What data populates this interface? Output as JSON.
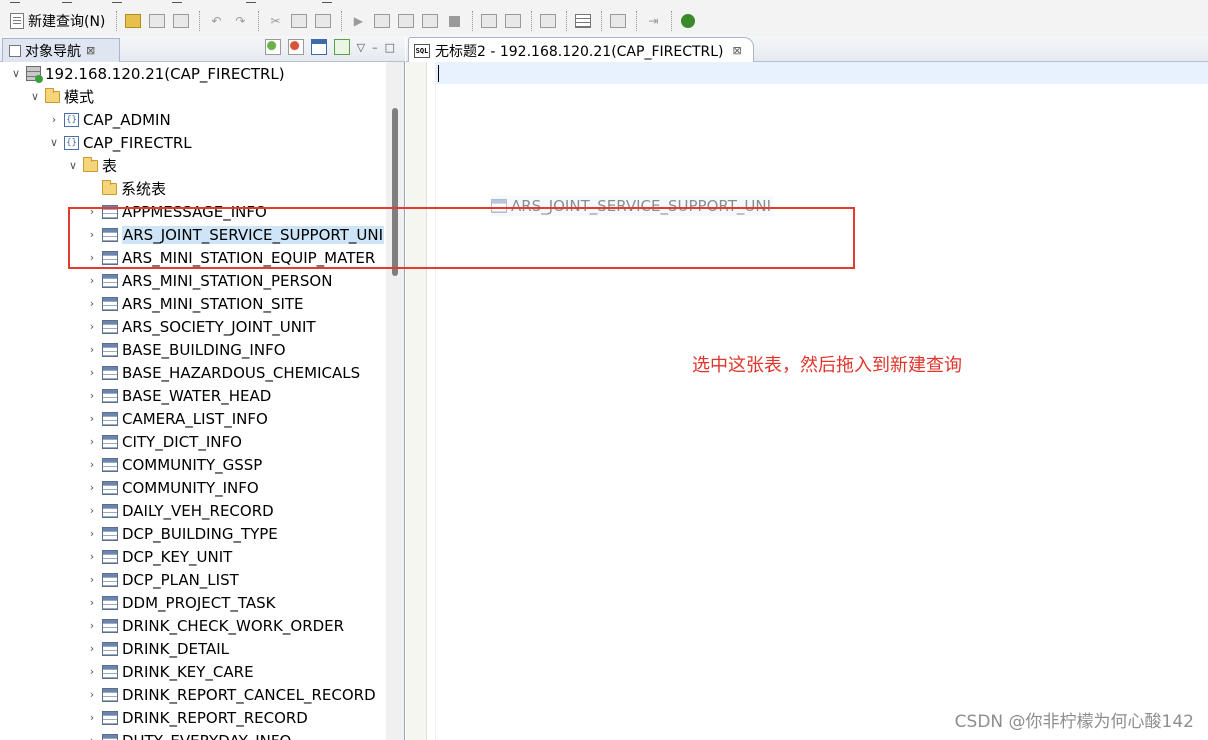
{
  "toolbar": {
    "new_query_label": "新建查询(N)"
  },
  "navigator": {
    "tab_label": "对象导航",
    "tab_close": "⊠",
    "menu_glyph": "▽",
    "minimize_glyph": "–",
    "maximize_glyph": "□"
  },
  "tree": {
    "connection": "192.168.120.21(CAP_FIRECTRL)",
    "schemas_folder": "模式",
    "schema_admin": "CAP_ADMIN",
    "schema_firectrl": "CAP_FIRECTRL",
    "tables_folder": "表",
    "system_tables": "系统表",
    "tables": [
      "APPMESSAGE_INFO",
      "ARS_JOINT_SERVICE_SUPPORT_UNI",
      "ARS_MINI_STATION_EQUIP_MATER",
      "ARS_MINI_STATION_PERSON",
      "ARS_MINI_STATION_SITE",
      "ARS_SOCIETY_JOINT_UNIT",
      "BASE_BUILDING_INFO",
      "BASE_HAZARDOUS_CHEMICALS",
      "BASE_WATER_HEAD",
      "CAMERA_LIST_INFO",
      "CITY_DICT_INFO",
      "COMMUNITY_GSSP",
      "COMMUNITY_INFO",
      "DAILY_VEH_RECORD",
      "DCP_BUILDING_TYPE",
      "DCP_KEY_UNIT",
      "DCP_PLAN_LIST",
      "DDM_PROJECT_TASK",
      "DRINK_CHECK_WORK_ORDER",
      "DRINK_DETAIL",
      "DRINK_KEY_CARE",
      "DRINK_REPORT_CANCEL_RECORD",
      "DRINK_REPORT_RECORD",
      "DUTY_EVERYDAY_INFO"
    ],
    "selected_index": 1
  },
  "editor": {
    "tab_title": "无标题2 - 192.168.120.21(CAP_FIRECTRL)",
    "tab_close": "⊠",
    "sql_icon_text": "SQL",
    "drag_ghost_label": "ARS_JOINT_SERVICE_SUPPORT_UNI"
  },
  "annotation": {
    "text": "选中这张表，然后拖入到新建查询",
    "color": "#e0352b"
  },
  "watermark": "CSDN @你非柠檬为何心酸142"
}
